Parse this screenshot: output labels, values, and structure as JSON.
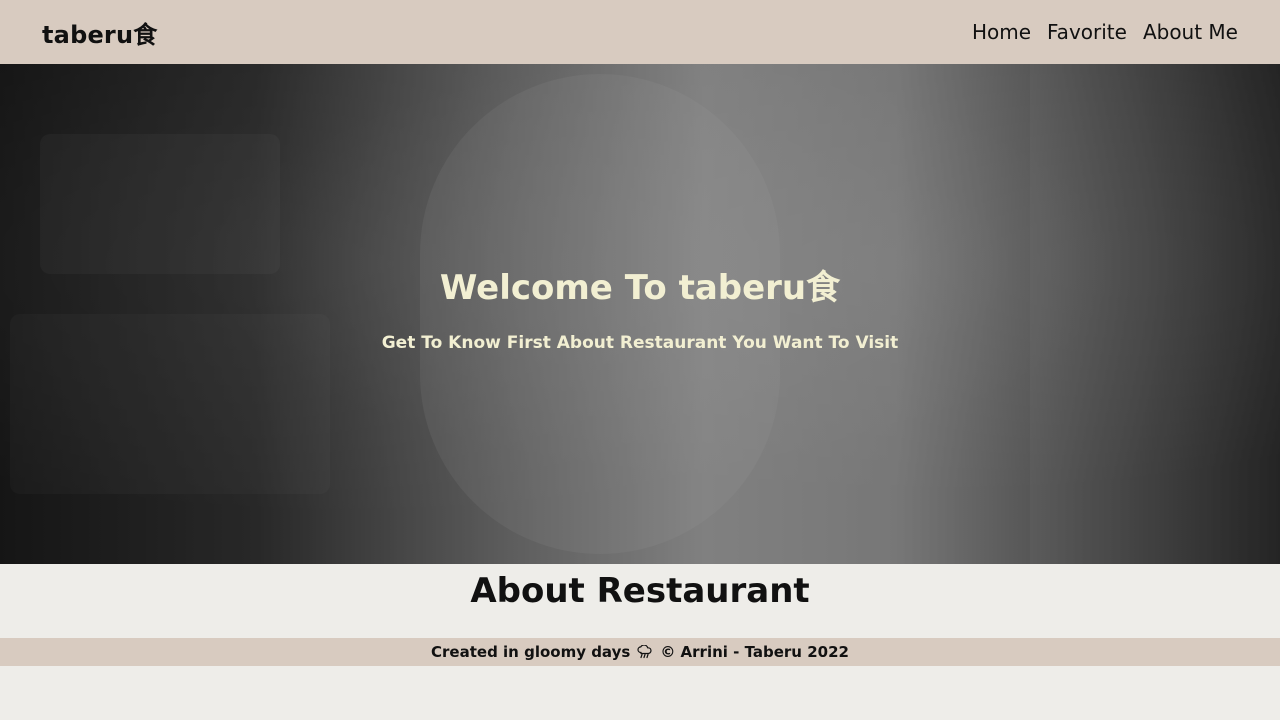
{
  "header": {
    "brand": "taberu食",
    "nav": [
      {
        "label": "Home"
      },
      {
        "label": "Favorite"
      },
      {
        "label": "About Me"
      }
    ]
  },
  "hero": {
    "title": "Welcome To taberu食",
    "subtitle": "Get To Know First About Restaurant You Want To Visit"
  },
  "main": {
    "section_title": "About Restaurant"
  },
  "footer": {
    "text_before_icon": "Created in gloomy days",
    "icon": "rain-cloud-icon",
    "text_after_icon": "© Arrini - Taberu 2022"
  },
  "colors": {
    "header_bg": "#D8CBC0",
    "page_bg": "#EEEDE9",
    "hero_text": "#F2EFD2",
    "text_dark": "#111111"
  }
}
